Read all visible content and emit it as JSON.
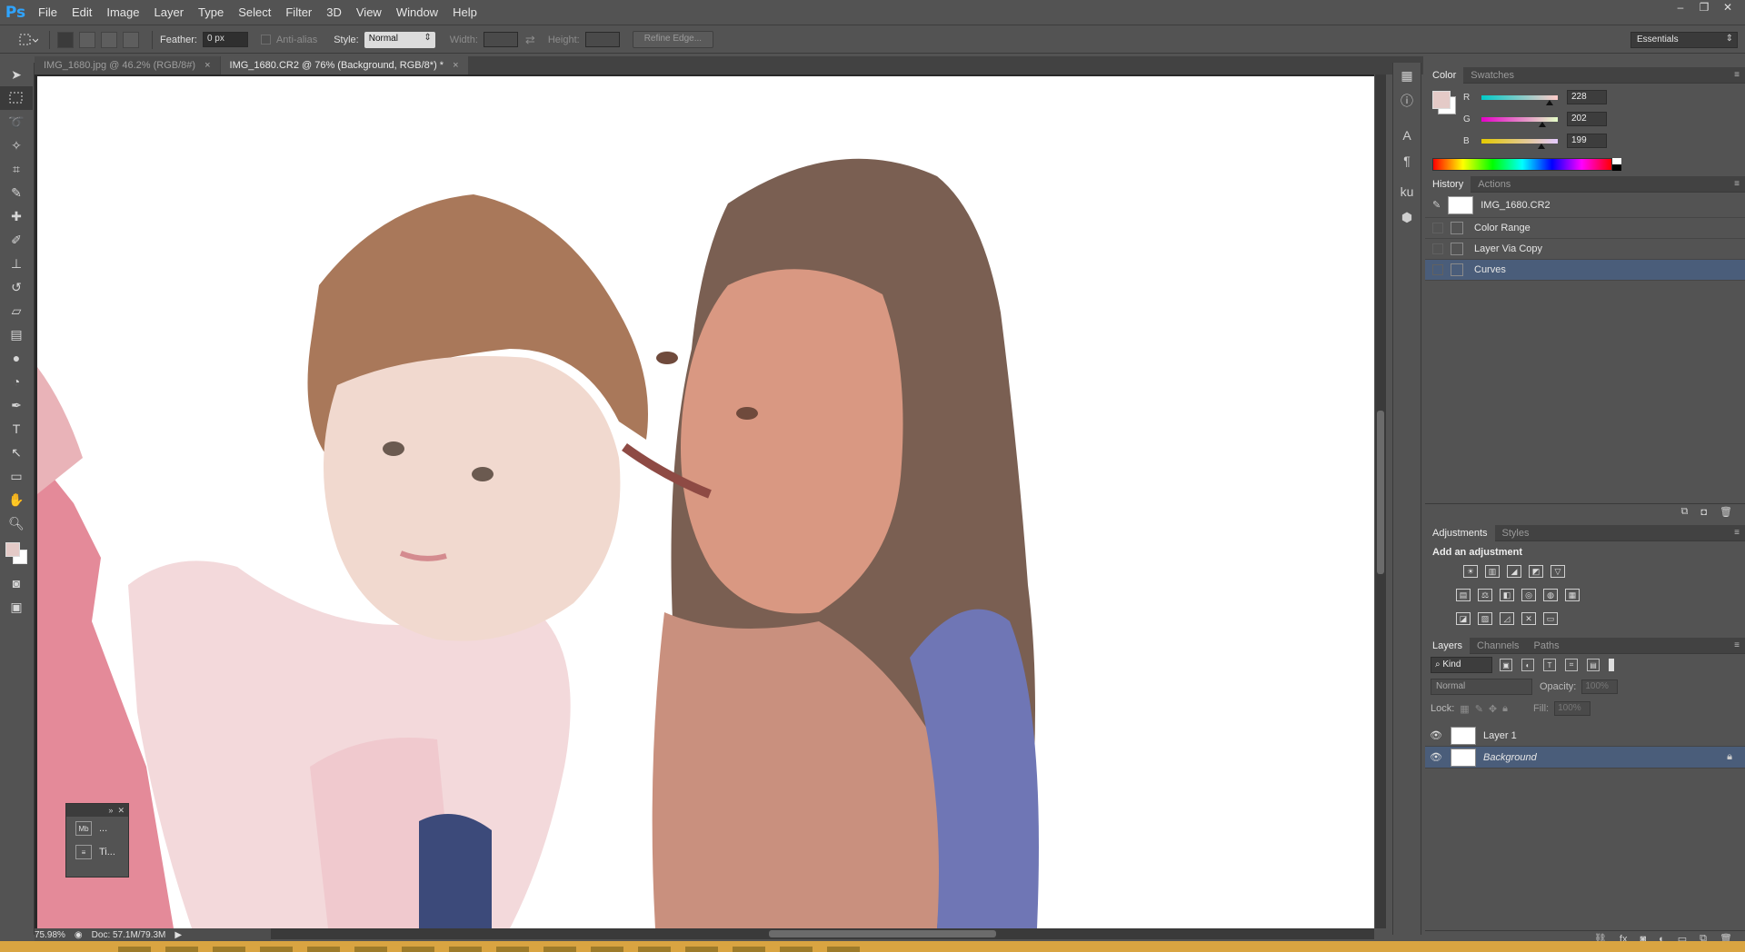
{
  "app": {
    "logo": "Ps"
  },
  "menu": [
    "File",
    "Edit",
    "Image",
    "Layer",
    "Type",
    "Select",
    "Filter",
    "3D",
    "View",
    "Window",
    "Help"
  ],
  "window_controls": {
    "minimize": "–",
    "restore": "❐",
    "close": "✕"
  },
  "options": {
    "feather_label": "Feather:",
    "feather_value": "0 px",
    "antialias_label": "Anti-alias",
    "style_label": "Style:",
    "style_value": "Normal",
    "width_label": "Width:",
    "height_label": "Height:",
    "refine_edge": "Refine Edge...",
    "workspace": "Essentials"
  },
  "doc_tabs": [
    {
      "label": "IMG_1680.jpg @ 46.2% (RGB/8#)",
      "active": false
    },
    {
      "label": "IMG_1680.CR2 @ 76% (Background, RGB/8*) *",
      "active": true
    }
  ],
  "status": {
    "zoom": "75.98%",
    "doc": "Doc: 57.1M/79.3M"
  },
  "mini_panel": {
    "row1": "...",
    "row2": "Ti..."
  },
  "color_panel": {
    "tabs": [
      "Color",
      "Swatches"
    ],
    "fg_color": "#e4cac7",
    "channels": [
      {
        "name": "R",
        "value": "228",
        "fraction": 0.894
      },
      {
        "name": "G",
        "value": "202",
        "fraction": 0.792
      },
      {
        "name": "B",
        "value": "199",
        "fraction": 0.78
      }
    ]
  },
  "history_panel": {
    "tabs": [
      "History",
      "Actions"
    ],
    "snapshot": "IMG_1680.CR2",
    "states": [
      {
        "label": "Color Range",
        "selected": false
      },
      {
        "label": "Layer Via Copy",
        "selected": false
      },
      {
        "label": "Curves",
        "selected": true
      }
    ]
  },
  "adjustments_panel": {
    "tabs": [
      "Adjustments",
      "Styles"
    ],
    "title": "Add an adjustment"
  },
  "layers_panel": {
    "tabs": [
      "Layers",
      "Channels",
      "Paths"
    ],
    "kind": "Kind",
    "blend_mode": "Normal",
    "opacity_label": "Opacity:",
    "opacity_value": "100%",
    "lock_label": "Lock:",
    "fill_label": "Fill:",
    "fill_value": "100%",
    "layers": [
      {
        "name": "Layer 1",
        "selected": false,
        "locked": false
      },
      {
        "name": "Background",
        "selected": true,
        "locked": true
      }
    ]
  }
}
